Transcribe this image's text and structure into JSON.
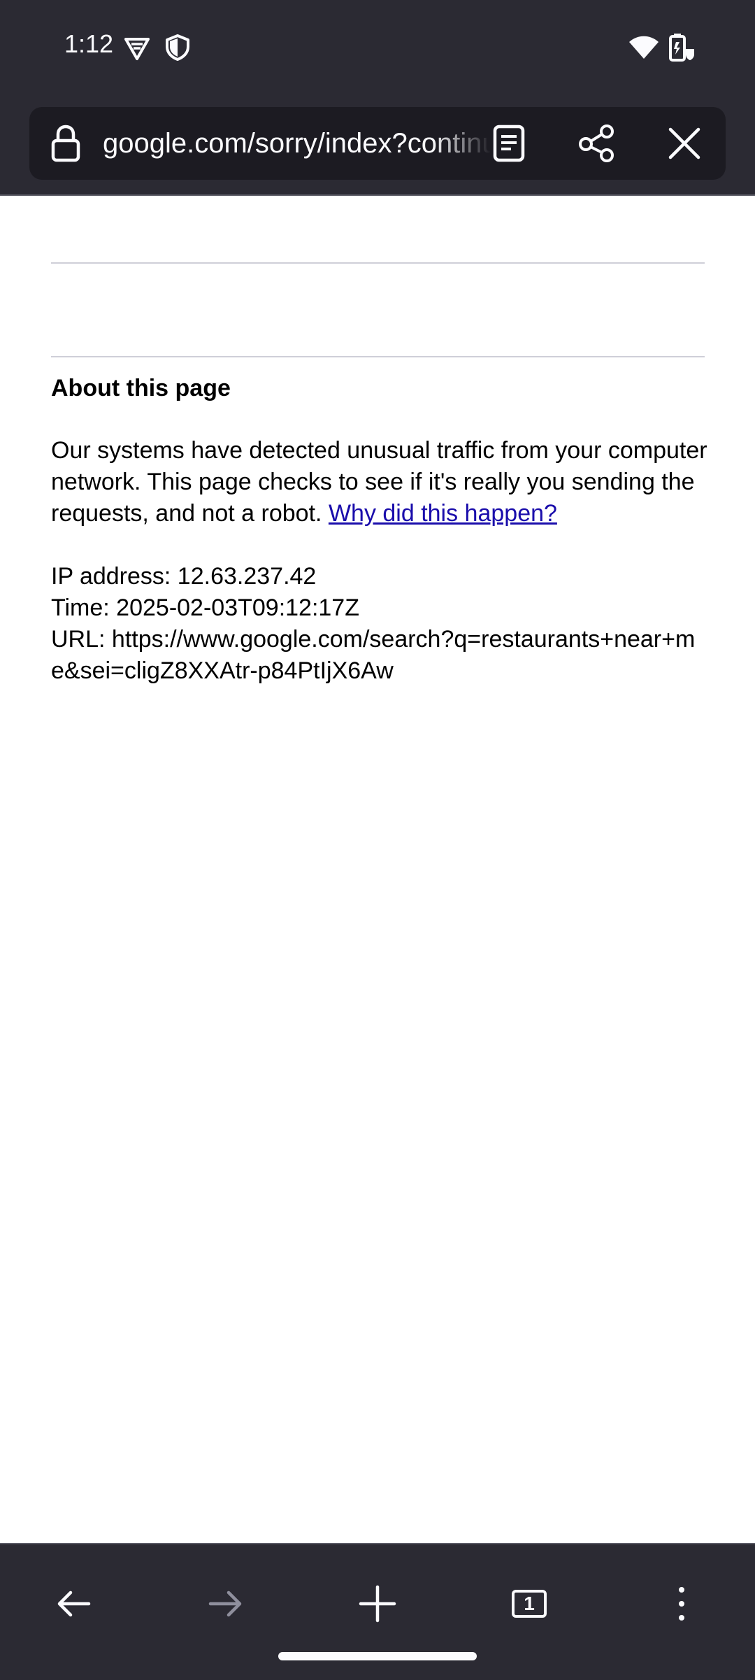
{
  "status_bar": {
    "time": "1:12"
  },
  "toolbar": {
    "url": "google.com/sorry/index?continue=https://www.google.com/search"
  },
  "page": {
    "about_title": "About this page",
    "paragraph": "Our systems have detected unusual traffic from your computer network. This page checks to see if it's really you sending the requests, and not a robot. ",
    "why_link": "Why did this happen?",
    "ip_line": "IP address: 12.63.237.42",
    "time_line": "Time: 2025-02-03T09:12:17Z",
    "url_line": "URL: https://www.google.com/search?q=restaurants+near+me&sei=cligZ8XXAtr-p84PtIjX6Aw"
  },
  "bottom_bar": {
    "tab_count": "1"
  },
  "icons": {
    "status": [
      "vpn-icon",
      "shield-icon",
      "wifi-icon",
      "battery-icon"
    ],
    "toolbar": [
      "lock-icon",
      "reader-view-icon",
      "share-icon",
      "close-icon"
    ],
    "bottom": [
      "back-arrow-icon",
      "forward-arrow-icon",
      "plus-icon",
      "tab-count-icon",
      "more-menu-icon"
    ]
  },
  "colors": {
    "chrome": "#2b2a33",
    "urlbar": "#1c1b22",
    "link": "#1a0dab",
    "text": "#000000"
  }
}
